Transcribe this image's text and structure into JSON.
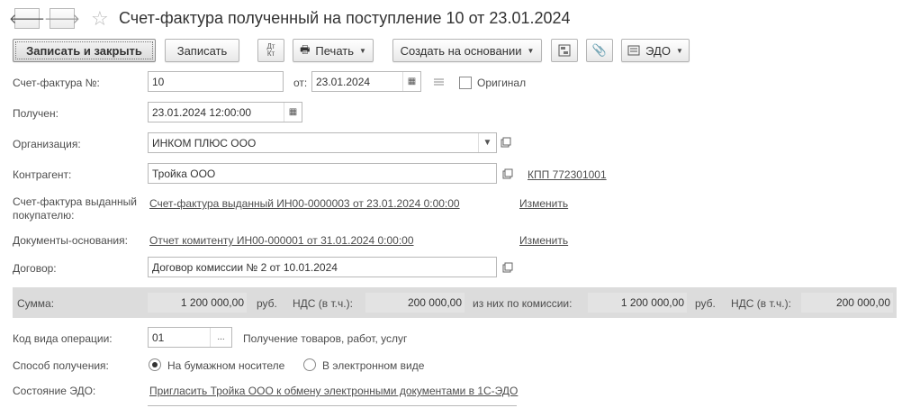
{
  "window": {
    "title": "Счет-фактура полученный на поступление 10 от 23.01.2024"
  },
  "nav": {
    "back_icon": "arrow-left-icon",
    "forward_icon": "arrow-right-icon",
    "favorite_icon": "star-icon"
  },
  "toolbar": {
    "save_close": "Записать и закрыть",
    "save": "Записать",
    "dtkt_top": "Дт",
    "dtkt_bottom": "Кт",
    "print": "Печать",
    "create_based": "Создать на основании",
    "edo": "ЭДО"
  },
  "form": {
    "invoice_no_label": "Счет-фактура №:",
    "invoice_no_value": "10",
    "from_label": "от:",
    "from_value": "23.01.2024",
    "original_label": "Оригинал",
    "original_checked": false,
    "received_label": "Получен:",
    "received_value": "23.01.2024 12:00:00",
    "org_label": "Организация:",
    "org_value": "ИНКОМ ПЛЮС ООО",
    "counterparty_label": "Контрагент:",
    "counterparty_value": "Тройка ООО",
    "kpp_link": "КПП 772301001",
    "issued_label_line1": "Счет-фактура выданный",
    "issued_label_line2": "покупателю:",
    "issued_link": "Счет-фактура выданный ИН00-0000003 от 23.01.2024 0:00:00",
    "issued_change": "Изменить",
    "basis_label": "Документы-основания:",
    "basis_link": "Отчет комитенту ИН00-000001 от 31.01.2024 0:00:00",
    "basis_change": "Изменить",
    "contract_label": "Договор:",
    "contract_value": "Договор комиссии № 2 от 10.01.2024"
  },
  "sums": {
    "sum_label": "Сумма:",
    "sum_value": "1 200 000,00",
    "rub1": "руб.",
    "vat_label1": "НДС (в т.ч.):",
    "vat_value1": "200 000,00",
    "commission_label": "из них по комиссии:",
    "commission_value": "1 200 000,00",
    "rub2": "руб.",
    "vat_label2": "НДС (в т.ч.):",
    "vat_value2": "200 000,00"
  },
  "operation": {
    "code_label": "Код вида операции:",
    "code_value": "01",
    "code_button": "...",
    "code_desc": "Получение товаров, работ, услуг",
    "method_label": "Способ получения:",
    "paper_option": "На бумажном носителе",
    "electronic_option": "В электронном виде",
    "selected": "paper",
    "edo_label": "Состояние ЭДО:",
    "edo_link": "Пригласить Тройка ООО к обмену электронными документами в 1С-ЭДО"
  }
}
